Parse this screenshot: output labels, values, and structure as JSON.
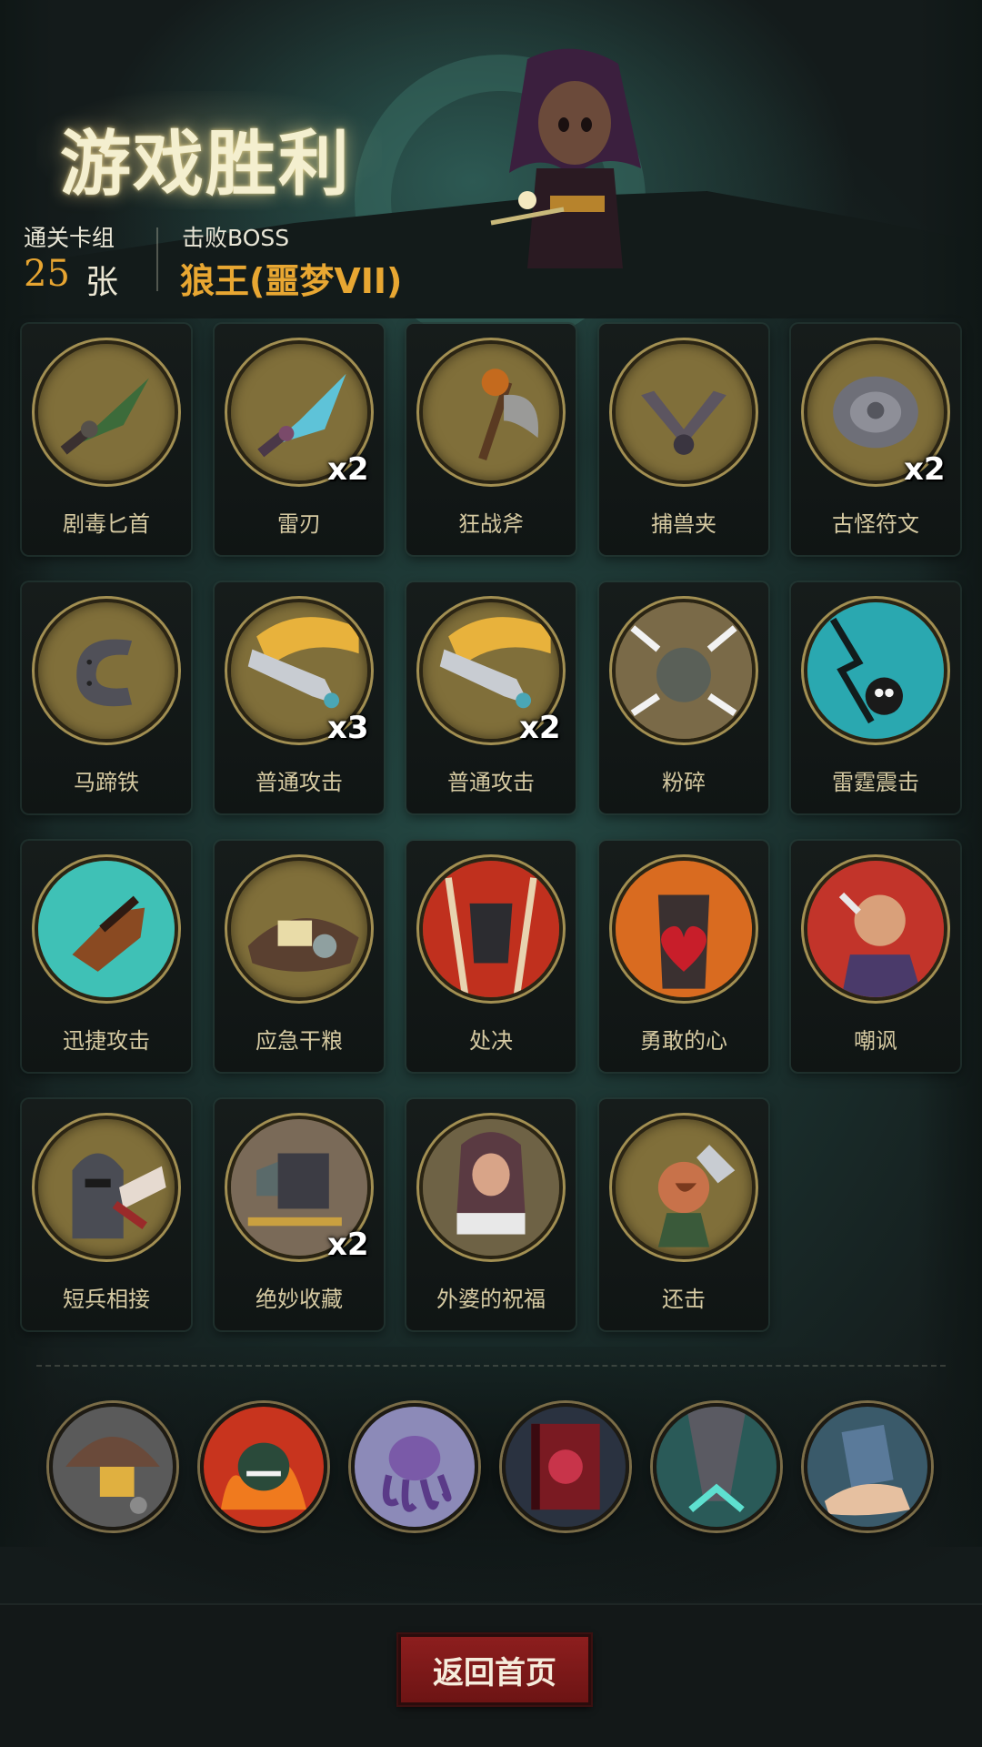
{
  "header": {
    "title": "游戏胜利",
    "cards_label": "通关卡组",
    "cards_count": "25",
    "cards_unit": "张",
    "boss_label": "击败BOSS",
    "boss_name": "狼王(噩梦VII)"
  },
  "cards": [
    {
      "name": "剧毒匕首",
      "count": "",
      "icon": "poison-dagger-icon"
    },
    {
      "name": "雷刃",
      "count": "x2",
      "icon": "thunder-blade-icon"
    },
    {
      "name": "狂战斧",
      "count": "",
      "icon": "berserker-axe-icon"
    },
    {
      "name": "捕兽夹",
      "count": "",
      "icon": "bear-trap-icon"
    },
    {
      "name": "古怪符文",
      "count": "x2",
      "icon": "strange-rune-icon"
    },
    {
      "name": "马蹄铁",
      "count": "",
      "icon": "horseshoe-icon"
    },
    {
      "name": "普通攻击",
      "count": "x3",
      "icon": "sword-attack-icon"
    },
    {
      "name": "普通攻击",
      "count": "x2",
      "icon": "sword-attack-icon"
    },
    {
      "name": "粉碎",
      "count": "",
      "icon": "smash-icon"
    },
    {
      "name": "雷霆震击",
      "count": "",
      "icon": "thunder-strike-icon"
    },
    {
      "name": "迅捷攻击",
      "count": "",
      "icon": "swift-attack-icon"
    },
    {
      "name": "应急干粮",
      "count": "",
      "icon": "rations-icon"
    },
    {
      "name": "处决",
      "count": "",
      "icon": "execute-icon"
    },
    {
      "name": "勇敢的心",
      "count": "",
      "icon": "brave-heart-icon"
    },
    {
      "name": "嘲讽",
      "count": "",
      "icon": "taunt-icon"
    },
    {
      "name": "短兵相接",
      "count": "",
      "icon": "close-combat-icon"
    },
    {
      "name": "绝妙收藏",
      "count": "x2",
      "icon": "collection-icon"
    },
    {
      "name": "外婆的祝福",
      "count": "",
      "icon": "grandma-blessing-icon"
    },
    {
      "name": "还击",
      "count": "",
      "icon": "counterattack-icon"
    }
  ],
  "relics": [
    {
      "icon": "mushroom-cheese-icon"
    },
    {
      "icon": "fire-demon-icon"
    },
    {
      "icon": "purple-octopus-icon"
    },
    {
      "icon": "red-book-icon"
    },
    {
      "icon": "stone-pillar-icon"
    },
    {
      "icon": "hand-card-icon"
    }
  ],
  "footer": {
    "home_label": "返回首页"
  },
  "colors": {
    "accent_gold": "#e8a732",
    "button_red": "#8d1e1e",
    "badge_olive": "#806f3a"
  }
}
